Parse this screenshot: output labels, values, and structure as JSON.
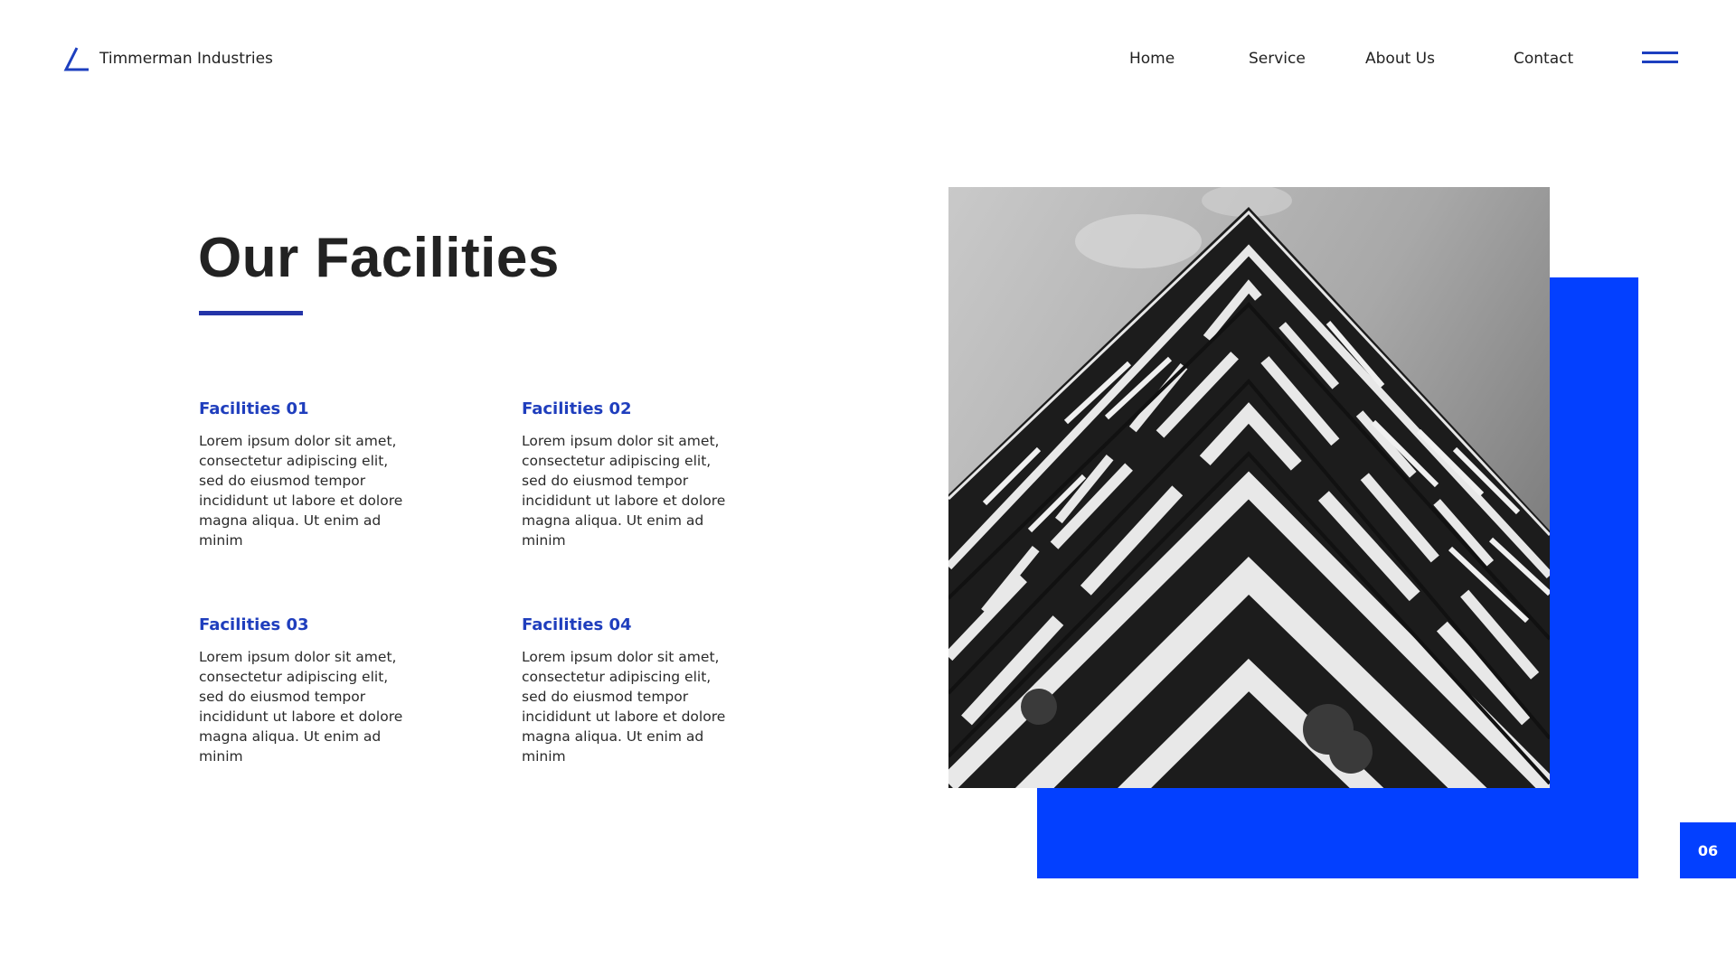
{
  "brand": {
    "name": "Timmerman Industries",
    "logo_icon": "triangle-logo-icon",
    "accent_color": "#1d3fbf"
  },
  "nav": {
    "items": [
      {
        "label": "Home"
      },
      {
        "label": "Service"
      },
      {
        "label": "About Us"
      },
      {
        "label": "Contact"
      }
    ],
    "menu_icon": "hamburger-menu-icon"
  },
  "main": {
    "title": "Our Facilities",
    "underline_color": "#2434a8",
    "facilities": [
      {
        "heading": "Facilities 01",
        "body": "Lorem ipsum dolor sit amet, consectetur adipiscing elit, sed do eiusmod tempor incididunt ut labore et dolore magna aliqua. Ut enim ad minim"
      },
      {
        "heading": "Facilities 02",
        "body": "Lorem ipsum dolor sit amet, consectetur adipiscing elit, sed do eiusmod tempor incididunt ut labore et dolore magna aliqua. Ut enim ad minim"
      },
      {
        "heading": "Facilities 03",
        "body": "Lorem ipsum dolor sit amet, consectetur adipiscing elit, sed do eiusmod tempor incididunt ut labore et dolore magna aliqua. Ut enim ad minim"
      },
      {
        "heading": "Facilities 04",
        "body": "Lorem ipsum dolor sit amet, consectetur adipiscing elit, sed do eiusmod tempor incididunt ut labore et dolore magna aliqua. Ut enim ad minim"
      }
    ]
  },
  "visual": {
    "photo_subject": "building-photo",
    "block_color": "#0340ff"
  },
  "footer": {
    "page_number": "06"
  }
}
